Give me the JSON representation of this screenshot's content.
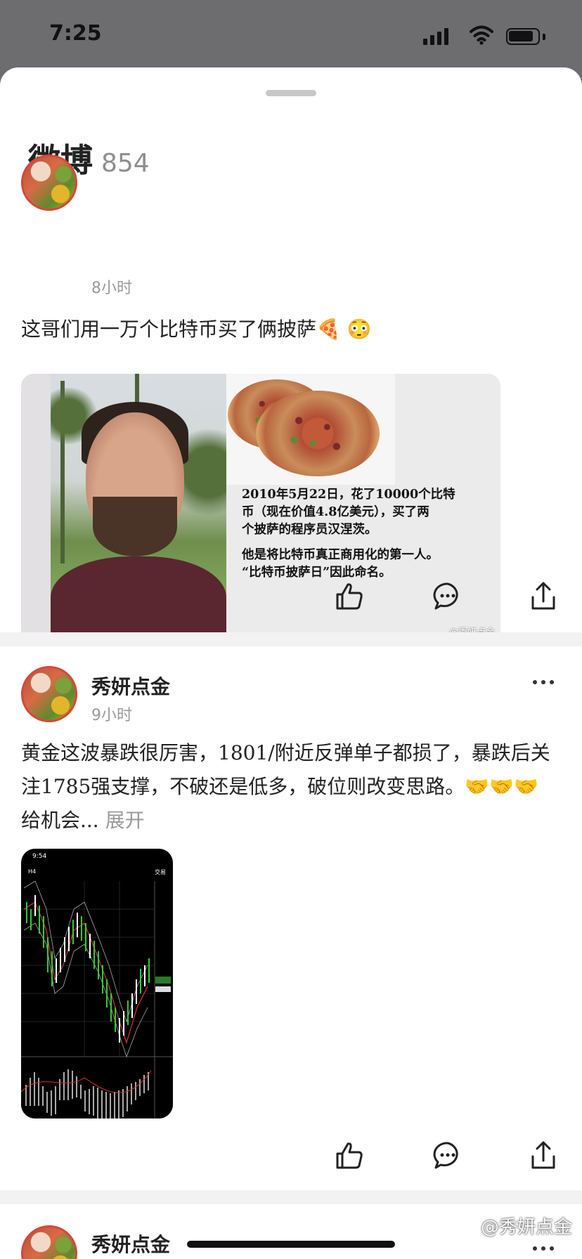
{
  "status": {
    "time": "7:25"
  },
  "sheet": {
    "title": "微博",
    "count": "854"
  },
  "posts": [
    {
      "time": "8小时",
      "text": "这哥们用一万个比特币买了俩披萨🍕 😳",
      "image": {
        "lines": [
          "2010年5月22日，花了10000个比特",
          "币（现在价值4.8亿美元），买了两",
          "个披萨的程序员汉涅茨。",
          "他是将比特币真正商用化的第一人。",
          "“比特币披萨日”因此命名。"
        ],
        "watermark": "@秀妍点金"
      }
    },
    {
      "author": "秀妍点金",
      "time": "9小时",
      "text": "黄金这波暴跌很厉害，1801/附近反弹单子都损了，暴跌后关注1785强支撑，不破还是低多，破位则改变思路。🤝🤝🤝 给机会...",
      "expand_label": "展开",
      "thumb": {
        "status_time": "9:54",
        "timeframe": "H4",
        "trade_label": "交易"
      }
    },
    {
      "author": "秀妍点金"
    }
  ],
  "page_watermark": "@秀妍点金"
}
